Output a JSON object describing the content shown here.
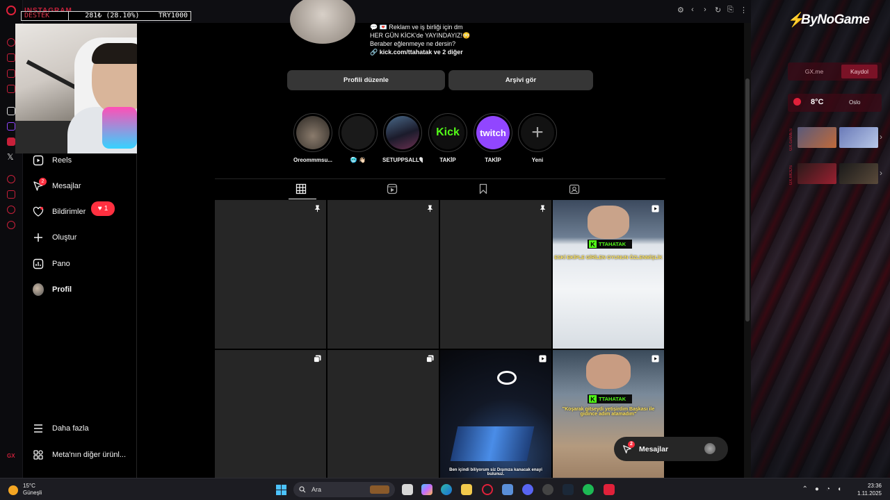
{
  "browser": {
    "tab_title": "INSTAGRAM",
    "nav": [
      "⚙",
      "‹",
      "›",
      "↻",
      "⎘",
      "⋮"
    ]
  },
  "stream_overlay": {
    "label": "DESTEK",
    "amount": "281₺ (28.10%)",
    "goal": "TRY1000"
  },
  "sidebar": {
    "items": [
      {
        "label": "Reels",
        "icon": "reels-icon"
      },
      {
        "label": "Mesajlar",
        "icon": "messenger-icon",
        "badge": "2"
      },
      {
        "label": "Bildirimler",
        "icon": "heart-icon"
      },
      {
        "label": "Oluştur",
        "icon": "plus-icon"
      },
      {
        "label": "Pano",
        "icon": "dashboard-icon"
      },
      {
        "label": "Profil",
        "icon": "avatar"
      },
      {
        "label": "Daha fazla",
        "icon": "menu-icon"
      },
      {
        "label": "Meta'nın diğer ürünl...",
        "icon": "meta-apps-icon"
      }
    ],
    "notification_pill": "1"
  },
  "profile": {
    "bio_lines": [
      "💬 💌 Reklam ve iş birliği için dm",
      "HER GÜN KİCK'de YAYINDAYIZ!😳",
      "Beraber eğlenmeye ne dersin?"
    ],
    "link": "kick.com/ttahatak ve 2 diğer",
    "edit_button": "Profili düzenle",
    "archive_button": "Arşivi gör"
  },
  "highlights": [
    {
      "label": "Oreommmsu...",
      "style": "photo"
    },
    {
      "label": "🥶 👋🏻",
      "style": "dark"
    },
    {
      "label": "SETUPPSALL🤍",
      "style": "setup"
    },
    {
      "label": "TAKİP",
      "style": "kick",
      "text": "Kick"
    },
    {
      "label": "TAKİP",
      "style": "twitch",
      "text": "twitch"
    },
    {
      "label": "Yeni",
      "style": "new",
      "text": "+"
    }
  ],
  "tabs": [
    "posts-tab",
    "reels-tab",
    "saved-tab",
    "tagged-tab"
  ],
  "posts": [
    {
      "type": "pinned",
      "bg": "dark"
    },
    {
      "type": "pinned",
      "bg": "dark"
    },
    {
      "type": "pinned",
      "bg": "dark"
    },
    {
      "type": "reel",
      "bg": "stream",
      "tag": "TTAHATAK",
      "caption": "ESKİ EKİPLE GİRİLEN OYUNUN ÖZLENMİŞLİK"
    },
    {
      "type": "carousel",
      "bg": "dark"
    },
    {
      "type": "carousel",
      "bg": "dark"
    },
    {
      "type": "reel",
      "bg": "setup",
      "caption": "Ben içindi biliyorum siz Dışınıza kanacak enayi bulunuz."
    },
    {
      "type": "reel",
      "bg": "stream2",
      "tag": "TTAHATAK",
      "caption": "\"Koşarak gitseydi yetişirdim Başkası ile gidince adım atamadım\""
    }
  ],
  "floating_messages": {
    "label": "Mesajlar",
    "badge": "2"
  },
  "gx_panel": {
    "brand": "ByNoGame",
    "gx_me": "GX.me",
    "record": "Kaydol",
    "temperature": "8°C",
    "city": "Oslo",
    "section1": "GX.GAMES",
    "section2": "GX.MODS"
  },
  "taskbar": {
    "weather_temp": "15°C",
    "weather_desc": "Güneşli",
    "search_placeholder": "Ara",
    "time": "23:36",
    "date": "1.11.2025"
  },
  "colors": {
    "accent": "#e0213a",
    "instagram_bg": "#000000",
    "button_bg": "#363636",
    "kick_green": "#53fc18",
    "twitch_purple": "#9146ff",
    "notification_red": "#ff3040"
  }
}
